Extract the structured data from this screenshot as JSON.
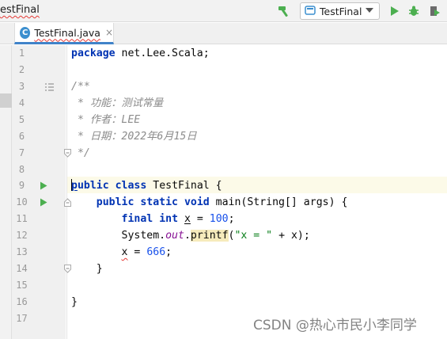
{
  "window": {
    "project_title": "estFinal"
  },
  "toolbar": {
    "run_config": "TestFinal"
  },
  "tab": {
    "file_name": "TestFinal.java",
    "close_glyph": "×",
    "file_type_badge": "C"
  },
  "editor": {
    "line_numbers": [
      "1",
      "2",
      "3",
      "4",
      "5",
      "6",
      "7",
      "8",
      "9",
      "10",
      "11",
      "12",
      "13",
      "14",
      "15",
      "16",
      "17"
    ],
    "code": {
      "l1_kw": "package",
      "l1_rest": " net.Lee.Scala;",
      "l3": "/**",
      "l4": " * 功能：测试常量",
      "l5": " * 作者：LEE",
      "l6": " * 日期：2022年6月15日",
      "l7": " */",
      "l9_first": "p",
      "l9_kw_tail": "ublic",
      "l9_space": " ",
      "l9_kw2": "class",
      "l9_rest": " TestFinal {",
      "l10_indent": "    ",
      "l10_kw1": "public",
      "l10_kw2": "static",
      "l10_kw3": "void",
      "l10_rest": " main(String[] args) {",
      "l11_indent": "        ",
      "l11_kw1": "final",
      "l11_kw2": "int",
      "l11_var": "x",
      "l11_eq": " = ",
      "l11_num": "100",
      "l11_end": ";",
      "l12_indent": "        ",
      "l12_cls": "System.",
      "l12_field": "out",
      "l12_dot": ".",
      "l12_method": "printf",
      "l12_paren": "(",
      "l12_str": "\"x = \"",
      "l12_rest": " + x);",
      "l13_indent": "        ",
      "l13_var": "x",
      "l13_eq": " = ",
      "l13_num": "666",
      "l13_end": ";",
      "l14": "    }",
      "l16": "}"
    }
  },
  "watermark": "CSDN @热心市民小李同学",
  "colors": {
    "keyword": "#0033b3",
    "number": "#1750eb",
    "string": "#067d17",
    "comment": "#8c8c8c",
    "static_field": "#871094",
    "run_green": "#4caf50",
    "caret_row": "#fcfae8",
    "tab_underline": "#4083c9"
  },
  "icons": {
    "build": "hammer-icon",
    "run": "run-icon",
    "debug": "debug-icon",
    "coverage": "coverage-icon",
    "gutter_run": "gutter-run-icon",
    "fold": "fold-icon",
    "doc": "doc-render-icon",
    "run_config": "run-config-icon"
  }
}
